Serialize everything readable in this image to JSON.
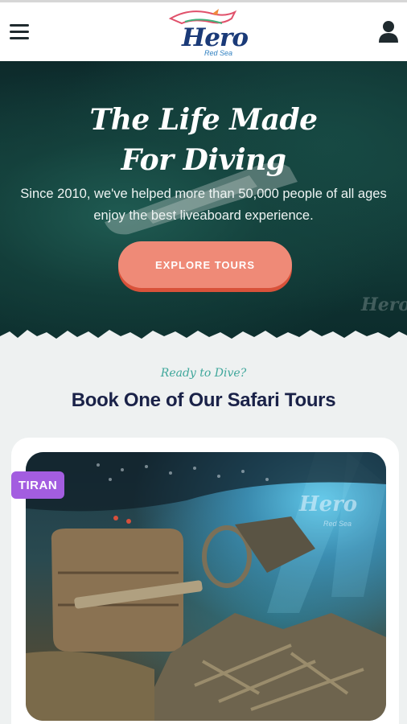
{
  "header": {
    "logo_word": "Hero",
    "logo_sub": "Red Sea"
  },
  "hero": {
    "title_line1": "The Life Made",
    "title_line2": "For Diving",
    "subtitle": "Since 2010, we've helped more than 50,000 people of all ages enjoy the best liveaboard experience.",
    "cta_label": "EXPLORE TOURS",
    "watermark": "Hero"
  },
  "section": {
    "eyebrow": "Ready to Dive?",
    "title": "Book One of Our Safari Tours"
  },
  "tour_card": {
    "badge": "TIRAN",
    "watermark": "Hero",
    "watermark_sub": "Red Sea"
  },
  "colors": {
    "accent_cta": "#ef8a77",
    "badge": "#a35de0",
    "title_navy": "#1a2248",
    "eyebrow_teal": "#3fa79b"
  }
}
